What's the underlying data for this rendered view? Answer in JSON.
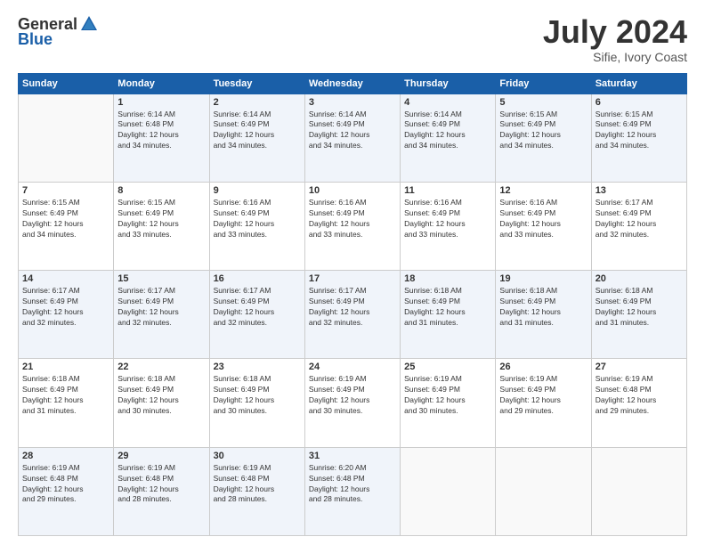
{
  "header": {
    "logo_general": "General",
    "logo_blue": "Blue",
    "month": "July 2024",
    "location": "Sifie, Ivory Coast"
  },
  "days_of_week": [
    "Sunday",
    "Monday",
    "Tuesday",
    "Wednesday",
    "Thursday",
    "Friday",
    "Saturday"
  ],
  "weeks": [
    [
      {
        "day": "",
        "info": ""
      },
      {
        "day": "1",
        "info": "Sunrise: 6:14 AM\nSunset: 6:48 PM\nDaylight: 12 hours\nand 34 minutes."
      },
      {
        "day": "2",
        "info": "Sunrise: 6:14 AM\nSunset: 6:49 PM\nDaylight: 12 hours\nand 34 minutes."
      },
      {
        "day": "3",
        "info": "Sunrise: 6:14 AM\nSunset: 6:49 PM\nDaylight: 12 hours\nand 34 minutes."
      },
      {
        "day": "4",
        "info": "Sunrise: 6:14 AM\nSunset: 6:49 PM\nDaylight: 12 hours\nand 34 minutes."
      },
      {
        "day": "5",
        "info": "Sunrise: 6:15 AM\nSunset: 6:49 PM\nDaylight: 12 hours\nand 34 minutes."
      },
      {
        "day": "6",
        "info": "Sunrise: 6:15 AM\nSunset: 6:49 PM\nDaylight: 12 hours\nand 34 minutes."
      }
    ],
    [
      {
        "day": "7",
        "info": "Sunrise: 6:15 AM\nSunset: 6:49 PM\nDaylight: 12 hours\nand 34 minutes."
      },
      {
        "day": "8",
        "info": "Sunrise: 6:15 AM\nSunset: 6:49 PM\nDaylight: 12 hours\nand 33 minutes."
      },
      {
        "day": "9",
        "info": "Sunrise: 6:16 AM\nSunset: 6:49 PM\nDaylight: 12 hours\nand 33 minutes."
      },
      {
        "day": "10",
        "info": "Sunrise: 6:16 AM\nSunset: 6:49 PM\nDaylight: 12 hours\nand 33 minutes."
      },
      {
        "day": "11",
        "info": "Sunrise: 6:16 AM\nSunset: 6:49 PM\nDaylight: 12 hours\nand 33 minutes."
      },
      {
        "day": "12",
        "info": "Sunrise: 6:16 AM\nSunset: 6:49 PM\nDaylight: 12 hours\nand 33 minutes."
      },
      {
        "day": "13",
        "info": "Sunrise: 6:17 AM\nSunset: 6:49 PM\nDaylight: 12 hours\nand 32 minutes."
      }
    ],
    [
      {
        "day": "14",
        "info": "Sunrise: 6:17 AM\nSunset: 6:49 PM\nDaylight: 12 hours\nand 32 minutes."
      },
      {
        "day": "15",
        "info": "Sunrise: 6:17 AM\nSunset: 6:49 PM\nDaylight: 12 hours\nand 32 minutes."
      },
      {
        "day": "16",
        "info": "Sunrise: 6:17 AM\nSunset: 6:49 PM\nDaylight: 12 hours\nand 32 minutes."
      },
      {
        "day": "17",
        "info": "Sunrise: 6:17 AM\nSunset: 6:49 PM\nDaylight: 12 hours\nand 32 minutes."
      },
      {
        "day": "18",
        "info": "Sunrise: 6:18 AM\nSunset: 6:49 PM\nDaylight: 12 hours\nand 31 minutes."
      },
      {
        "day": "19",
        "info": "Sunrise: 6:18 AM\nSunset: 6:49 PM\nDaylight: 12 hours\nand 31 minutes."
      },
      {
        "day": "20",
        "info": "Sunrise: 6:18 AM\nSunset: 6:49 PM\nDaylight: 12 hours\nand 31 minutes."
      }
    ],
    [
      {
        "day": "21",
        "info": "Sunrise: 6:18 AM\nSunset: 6:49 PM\nDaylight: 12 hours\nand 31 minutes."
      },
      {
        "day": "22",
        "info": "Sunrise: 6:18 AM\nSunset: 6:49 PM\nDaylight: 12 hours\nand 30 minutes."
      },
      {
        "day": "23",
        "info": "Sunrise: 6:18 AM\nSunset: 6:49 PM\nDaylight: 12 hours\nand 30 minutes."
      },
      {
        "day": "24",
        "info": "Sunrise: 6:19 AM\nSunset: 6:49 PM\nDaylight: 12 hours\nand 30 minutes."
      },
      {
        "day": "25",
        "info": "Sunrise: 6:19 AM\nSunset: 6:49 PM\nDaylight: 12 hours\nand 30 minutes."
      },
      {
        "day": "26",
        "info": "Sunrise: 6:19 AM\nSunset: 6:49 PM\nDaylight: 12 hours\nand 29 minutes."
      },
      {
        "day": "27",
        "info": "Sunrise: 6:19 AM\nSunset: 6:48 PM\nDaylight: 12 hours\nand 29 minutes."
      }
    ],
    [
      {
        "day": "28",
        "info": "Sunrise: 6:19 AM\nSunset: 6:48 PM\nDaylight: 12 hours\nand 29 minutes."
      },
      {
        "day": "29",
        "info": "Sunrise: 6:19 AM\nSunset: 6:48 PM\nDaylight: 12 hours\nand 28 minutes."
      },
      {
        "day": "30",
        "info": "Sunrise: 6:19 AM\nSunset: 6:48 PM\nDaylight: 12 hours\nand 28 minutes."
      },
      {
        "day": "31",
        "info": "Sunrise: 6:20 AM\nSunset: 6:48 PM\nDaylight: 12 hours\nand 28 minutes."
      },
      {
        "day": "",
        "info": ""
      },
      {
        "day": "",
        "info": ""
      },
      {
        "day": "",
        "info": ""
      }
    ]
  ]
}
